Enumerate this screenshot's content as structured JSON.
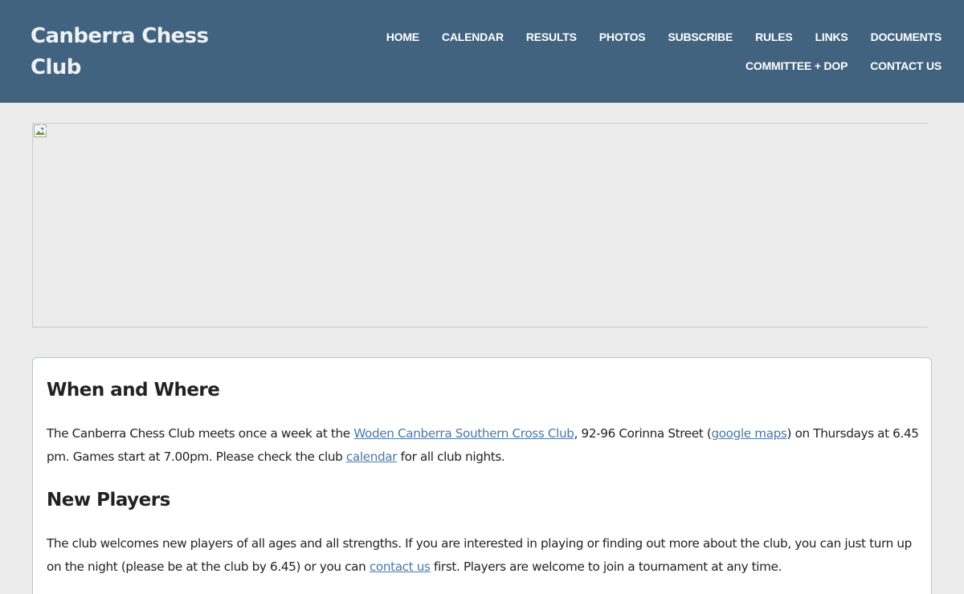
{
  "header": {
    "site_title": "Canberra Chess Club",
    "nav_row1": [
      "HOME",
      "CALENDAR",
      "RESULTS",
      "PHOTOS",
      "SUBSCRIBE",
      "RULES",
      "LINKS",
      "DOCUMENTS"
    ],
    "nav_row2": [
      "COMMITTEE + DOP",
      "CONTACT US"
    ]
  },
  "hero": {
    "icon": "broken-image-icon"
  },
  "content": {
    "when_where": {
      "heading": "When and Where",
      "text_1": "The Canberra Chess Club meets once a week at the ",
      "link_venue": "Woden Canberra Southern Cross Club",
      "text_2": ", 92-96 Corinna Street (",
      "link_maps": "google maps",
      "text_3": ") on Thursdays at 6.45 pm. Games start at 7.00pm. Please check the club ",
      "link_calendar": "calendar",
      "text_4": " for all club nights."
    },
    "new_players": {
      "heading": "New Players",
      "text_1": "The club welcomes new players of all ages and all strengths. If you are interested in playing or finding out more about the club, you can just turn up on the night (please be at the club by 6.45) or you can ",
      "link_contact": "contact us",
      "text_2": " first. Players are welcome to join a tournament at any time."
    }
  },
  "colors": {
    "header_bg": "#41637f",
    "page_bg": "#ebeceb",
    "link": "#4a78a6"
  }
}
